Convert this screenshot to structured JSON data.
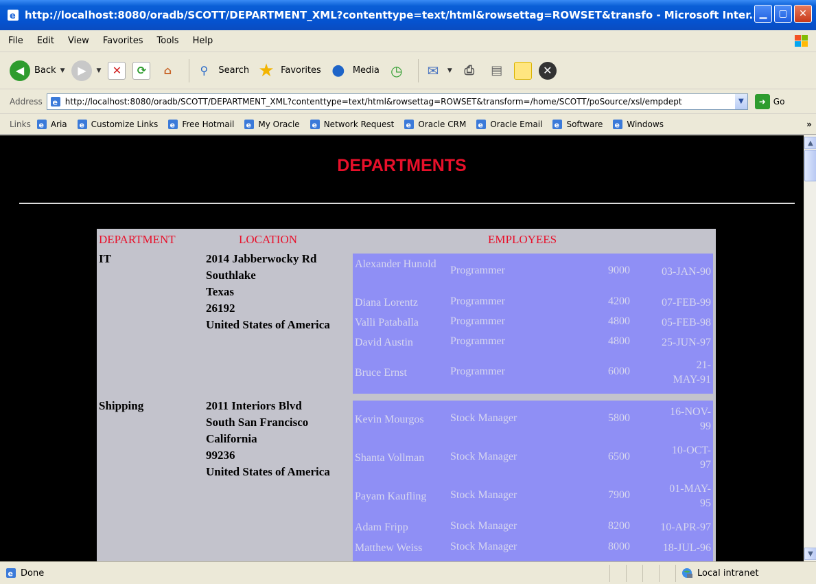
{
  "window": {
    "title": "http://localhost:8080/oradb/SCOTT/DEPARTMENT_XML?contenttype=text/html&rowsettag=ROWSET&transfo - Microsoft Inter..."
  },
  "menu": [
    "File",
    "Edit",
    "View",
    "Favorites",
    "Tools",
    "Help"
  ],
  "toolbar": {
    "back": "Back",
    "search": "Search",
    "favorites": "Favorites",
    "media": "Media"
  },
  "address": {
    "label": "Address",
    "url": "http://localhost:8080/oradb/SCOTT/DEPARTMENT_XML?contenttype=text/html&rowsettag=ROWSET&transform=/home/SCOTT/poSource/xsl/empdept",
    "go": "Go"
  },
  "links": {
    "label": "Links",
    "items": [
      "Aria",
      "Customize Links",
      "Free Hotmail",
      "My Oracle",
      "Network Request",
      "Oracle CRM",
      "Oracle Email",
      "Software",
      "Windows"
    ],
    "more": "»"
  },
  "page": {
    "heading": "DEPARTMENTS",
    "headers": {
      "department": "DEPARTMENT",
      "location": "LOCATION",
      "employees": "EMPLOYEES"
    },
    "departments": [
      {
        "name": "IT",
        "location": [
          "2014 Jabberwocky Rd",
          "Southlake",
          "Texas",
          "26192",
          "United States of America"
        ],
        "employees": [
          {
            "name": "Alexander Hunold",
            "job": "Programmer",
            "salary": "9000",
            "hired": "03-JAN-90"
          },
          {
            "name": "Diana Lorentz",
            "job": "Programmer",
            "salary": "4200",
            "hired": "07-FEB-99"
          },
          {
            "name": "Valli Pataballa",
            "job": "Programmer",
            "salary": "4800",
            "hired": "05-FEB-98"
          },
          {
            "name": "David Austin",
            "job": "Programmer",
            "salary": "4800",
            "hired": "25-JUN-97"
          },
          {
            "name": "Bruce Ernst",
            "job": "Programmer",
            "salary": "6000",
            "hired": "21-MAY-91"
          }
        ]
      },
      {
        "name": "Shipping",
        "location": [
          "2011 Interiors Blvd",
          "South San Francisco",
          "California",
          "99236",
          "United States of America"
        ],
        "employees": [
          {
            "name": "Kevin Mourgos",
            "job": "Stock Manager",
            "salary": "5800",
            "hired": "16-NOV-99"
          },
          {
            "name": "Shanta Vollman",
            "job": "Stock Manager",
            "salary": "6500",
            "hired": "10-OCT-97"
          },
          {
            "name": "Payam Kaufling",
            "job": "Stock Manager",
            "salary": "7900",
            "hired": "01-MAY-95"
          },
          {
            "name": "Adam Fripp",
            "job": "Stock Manager",
            "salary": "8200",
            "hired": "10-APR-97"
          },
          {
            "name": "Matthew Weiss",
            "job": "Stock Manager",
            "salary": "8000",
            "hired": "18-JUL-96"
          }
        ]
      }
    ]
  },
  "status": {
    "text": "Done",
    "zone": "Local intranet"
  },
  "colors": {
    "heading": "#e8102a",
    "table_bg": "#c3c3cc",
    "employee_bg": "#8f8ff5",
    "employee_text": "#d6d6ef",
    "page_bg": "#000000"
  }
}
